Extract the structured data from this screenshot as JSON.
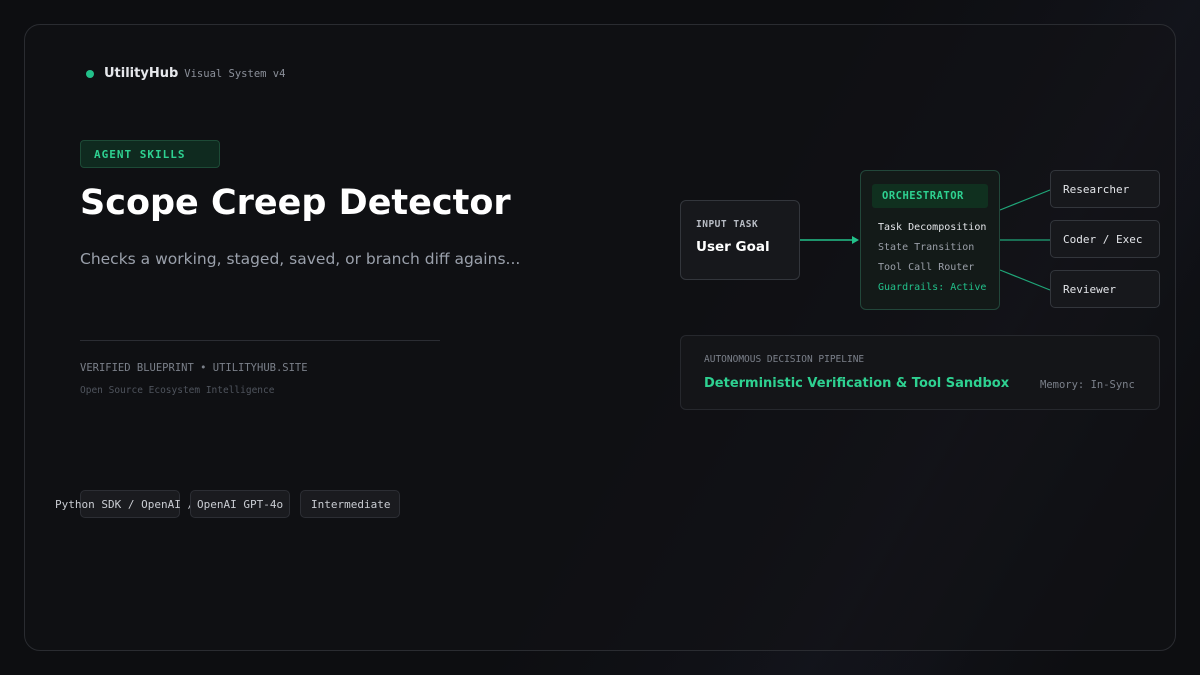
{
  "brand": {
    "name": "UtilityHub",
    "subtitle": "Visual System v4"
  },
  "hero": {
    "badge": "AGENT SKILLS",
    "title": "Scope Creep Detector",
    "description": "Checks a working, staged, saved, or branch diff agains..."
  },
  "footer": {
    "verified": "VERIFIED BLUEPRINT • UTILITYHUB.SITE",
    "subline": "Open Source Ecosystem Intelligence"
  },
  "tags": [
    "Python SDK / OpenAI / ",
    "OpenAI GPT-4o",
    "Intermediate"
  ],
  "diagram": {
    "input": {
      "label": "INPUT TASK",
      "value": "User Goal"
    },
    "orchestrator": {
      "title": "ORCHESTRATOR",
      "items": [
        "Task Decomposition",
        "State Transition",
        "Tool Call Router",
        "Guardrails: Active"
      ]
    },
    "agents": [
      "Researcher",
      "Coder / Exec",
      "Reviewer"
    ]
  },
  "pipeline": {
    "label": "AUTONOMOUS DECISION PIPELINE",
    "title": "Deterministic Verification & Tool Sandbox",
    "memory": "Memory: In-Sync"
  },
  "colors": {
    "accent": "#22c08a",
    "background": "#0d0e11"
  }
}
